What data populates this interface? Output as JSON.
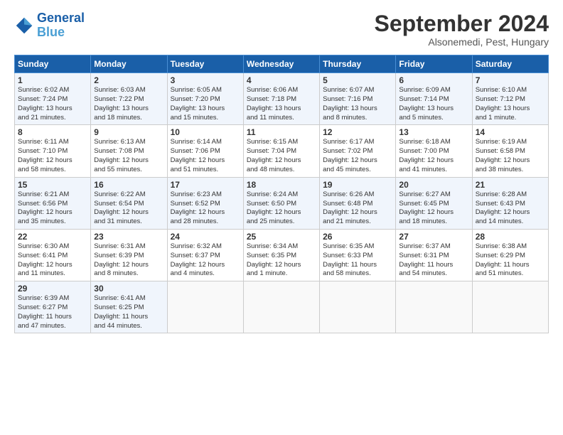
{
  "logo": {
    "line1": "General",
    "line2": "Blue"
  },
  "title": "September 2024",
  "location": "Alsonemedi, Pest, Hungary",
  "days_header": [
    "Sunday",
    "Monday",
    "Tuesday",
    "Wednesday",
    "Thursday",
    "Friday",
    "Saturday"
  ],
  "weeks": [
    [
      {
        "day": "1",
        "lines": [
          "Sunrise: 6:02 AM",
          "Sunset: 7:24 PM",
          "Daylight: 13 hours",
          "and 21 minutes."
        ]
      },
      {
        "day": "2",
        "lines": [
          "Sunrise: 6:03 AM",
          "Sunset: 7:22 PM",
          "Daylight: 13 hours",
          "and 18 minutes."
        ]
      },
      {
        "day": "3",
        "lines": [
          "Sunrise: 6:05 AM",
          "Sunset: 7:20 PM",
          "Daylight: 13 hours",
          "and 15 minutes."
        ]
      },
      {
        "day": "4",
        "lines": [
          "Sunrise: 6:06 AM",
          "Sunset: 7:18 PM",
          "Daylight: 13 hours",
          "and 11 minutes."
        ]
      },
      {
        "day": "5",
        "lines": [
          "Sunrise: 6:07 AM",
          "Sunset: 7:16 PM",
          "Daylight: 13 hours",
          "and 8 minutes."
        ]
      },
      {
        "day": "6",
        "lines": [
          "Sunrise: 6:09 AM",
          "Sunset: 7:14 PM",
          "Daylight: 13 hours",
          "and 5 minutes."
        ]
      },
      {
        "day": "7",
        "lines": [
          "Sunrise: 6:10 AM",
          "Sunset: 7:12 PM",
          "Daylight: 13 hours",
          "and 1 minute."
        ]
      }
    ],
    [
      {
        "day": "8",
        "lines": [
          "Sunrise: 6:11 AM",
          "Sunset: 7:10 PM",
          "Daylight: 12 hours",
          "and 58 minutes."
        ]
      },
      {
        "day": "9",
        "lines": [
          "Sunrise: 6:13 AM",
          "Sunset: 7:08 PM",
          "Daylight: 12 hours",
          "and 55 minutes."
        ]
      },
      {
        "day": "10",
        "lines": [
          "Sunrise: 6:14 AM",
          "Sunset: 7:06 PM",
          "Daylight: 12 hours",
          "and 51 minutes."
        ]
      },
      {
        "day": "11",
        "lines": [
          "Sunrise: 6:15 AM",
          "Sunset: 7:04 PM",
          "Daylight: 12 hours",
          "and 48 minutes."
        ]
      },
      {
        "day": "12",
        "lines": [
          "Sunrise: 6:17 AM",
          "Sunset: 7:02 PM",
          "Daylight: 12 hours",
          "and 45 minutes."
        ]
      },
      {
        "day": "13",
        "lines": [
          "Sunrise: 6:18 AM",
          "Sunset: 7:00 PM",
          "Daylight: 12 hours",
          "and 41 minutes."
        ]
      },
      {
        "day": "14",
        "lines": [
          "Sunrise: 6:19 AM",
          "Sunset: 6:58 PM",
          "Daylight: 12 hours",
          "and 38 minutes."
        ]
      }
    ],
    [
      {
        "day": "15",
        "lines": [
          "Sunrise: 6:21 AM",
          "Sunset: 6:56 PM",
          "Daylight: 12 hours",
          "and 35 minutes."
        ]
      },
      {
        "day": "16",
        "lines": [
          "Sunrise: 6:22 AM",
          "Sunset: 6:54 PM",
          "Daylight: 12 hours",
          "and 31 minutes."
        ]
      },
      {
        "day": "17",
        "lines": [
          "Sunrise: 6:23 AM",
          "Sunset: 6:52 PM",
          "Daylight: 12 hours",
          "and 28 minutes."
        ]
      },
      {
        "day": "18",
        "lines": [
          "Sunrise: 6:24 AM",
          "Sunset: 6:50 PM",
          "Daylight: 12 hours",
          "and 25 minutes."
        ]
      },
      {
        "day": "19",
        "lines": [
          "Sunrise: 6:26 AM",
          "Sunset: 6:48 PM",
          "Daylight: 12 hours",
          "and 21 minutes."
        ]
      },
      {
        "day": "20",
        "lines": [
          "Sunrise: 6:27 AM",
          "Sunset: 6:45 PM",
          "Daylight: 12 hours",
          "and 18 minutes."
        ]
      },
      {
        "day": "21",
        "lines": [
          "Sunrise: 6:28 AM",
          "Sunset: 6:43 PM",
          "Daylight: 12 hours",
          "and 14 minutes."
        ]
      }
    ],
    [
      {
        "day": "22",
        "lines": [
          "Sunrise: 6:30 AM",
          "Sunset: 6:41 PM",
          "Daylight: 12 hours",
          "and 11 minutes."
        ]
      },
      {
        "day": "23",
        "lines": [
          "Sunrise: 6:31 AM",
          "Sunset: 6:39 PM",
          "Daylight: 12 hours",
          "and 8 minutes."
        ]
      },
      {
        "day": "24",
        "lines": [
          "Sunrise: 6:32 AM",
          "Sunset: 6:37 PM",
          "Daylight: 12 hours",
          "and 4 minutes."
        ]
      },
      {
        "day": "25",
        "lines": [
          "Sunrise: 6:34 AM",
          "Sunset: 6:35 PM",
          "Daylight: 12 hours",
          "and 1 minute."
        ]
      },
      {
        "day": "26",
        "lines": [
          "Sunrise: 6:35 AM",
          "Sunset: 6:33 PM",
          "Daylight: 11 hours",
          "and 58 minutes."
        ]
      },
      {
        "day": "27",
        "lines": [
          "Sunrise: 6:37 AM",
          "Sunset: 6:31 PM",
          "Daylight: 11 hours",
          "and 54 minutes."
        ]
      },
      {
        "day": "28",
        "lines": [
          "Sunrise: 6:38 AM",
          "Sunset: 6:29 PM",
          "Daylight: 11 hours",
          "and 51 minutes."
        ]
      }
    ],
    [
      {
        "day": "29",
        "lines": [
          "Sunrise: 6:39 AM",
          "Sunset: 6:27 PM",
          "Daylight: 11 hours",
          "and 47 minutes."
        ]
      },
      {
        "day": "30",
        "lines": [
          "Sunrise: 6:41 AM",
          "Sunset: 6:25 PM",
          "Daylight: 11 hours",
          "and 44 minutes."
        ]
      },
      null,
      null,
      null,
      null,
      null
    ]
  ]
}
